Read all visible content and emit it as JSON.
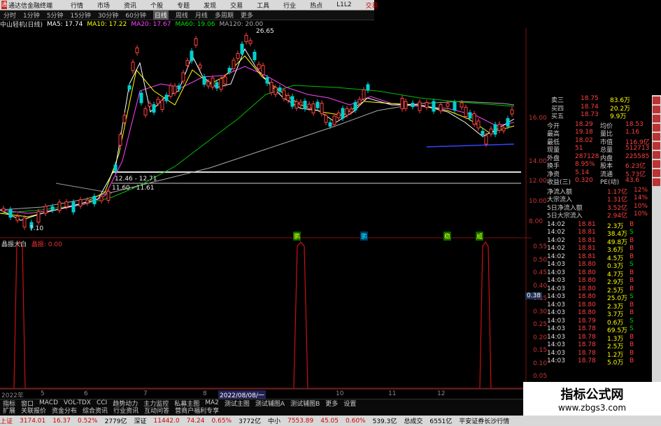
{
  "title": {
    "app": "通达信金融终端",
    "menus": [
      "行情",
      "市场",
      "资讯",
      "个股",
      "专题",
      "发现",
      "交易",
      "工具",
      "行业",
      "热点",
      "L1L2"
    ],
    "right": "交易"
  },
  "tabs": [
    "分时",
    "1分钟",
    "5分钟",
    "15分钟",
    "30分钟",
    "60分钟",
    "日线",
    "周线",
    "月线",
    "多周期",
    "更多"
  ],
  "active_tab": "日线",
  "stock_label": "中山轻机(日线)",
  "ma": [
    {
      "label": "MA5: 17.74",
      "color": "#ffffff"
    },
    {
      "label": "MA10: 17.22",
      "color": "#ffff00"
    },
    {
      "label": "MA20: 17.67",
      "color": "#ff44ff"
    },
    {
      "label": "MA60: 19.06",
      "color": "#00e000"
    },
    {
      "label": "MA120: 20.00",
      "color": "#aaaaaa"
    }
  ],
  "price_annotations": {
    "high": "26.65",
    "low": "7.10",
    "line1": "12.46 - 12.71",
    "line2": "11.60 - 11.61"
  },
  "price_axis": [
    "16.00",
    "14.00",
    "12.00",
    "10.00",
    "8.00"
  ],
  "indicator": {
    "name": "晶振大白",
    "value": "晶振: 0.00",
    "markers": [
      "鹏",
      "鹏",
      "稳",
      "威"
    ],
    "axis": [
      "0.55",
      "0.50",
      "0.45",
      "0.40",
      "0.35",
      "0.30",
      "0.25",
      "0.20",
      "0.15",
      "0.10",
      "0.05"
    ],
    "cursor": "0.38"
  },
  "date_labels": [
    "2022年",
    "5",
    "6",
    "7",
    "8",
    "2022/08/08/一",
    "10",
    "11",
    "12"
  ],
  "toolbar1": [
    "指标",
    "窗口",
    "MACD",
    "VOL-TDX",
    "CCI",
    "趋势动力",
    "主力监控",
    "私募主图",
    "MA2",
    "测试主图",
    "测试辅图A",
    "测试辅图B",
    "更多",
    "设置"
  ],
  "toolbar2": [
    "扩展",
    "关联报价",
    "资金分布",
    "综合资讯",
    "行业资讯",
    "互动问答",
    "营商户福利专享"
  ],
  "quote_rows": [
    {
      "l": "卖三",
      "p": "18.75",
      "v": "83.6万"
    },
    {
      "l": "买四",
      "p": "18.74",
      "v": "20.2万"
    },
    {
      "l": "买五",
      "p": "18.73",
      "v": "9.9万"
    }
  ],
  "stats": [
    {
      "l1": "今开",
      "v1": "18.29",
      "l2": "均价",
      "v2": "18.53"
    },
    {
      "l1": "最高",
      "v1": "19.18",
      "l2": "量比",
      "v2": "1.16"
    },
    {
      "l1": "最低",
      "v1": "18.02",
      "l2": "市值",
      "v2": "116.9亿"
    },
    {
      "l1": "现量",
      "v1": "51",
      "l2": "总量",
      "v2": "512713"
    },
    {
      "l1": "外盘",
      "v1": "287128",
      "l2": "内盘",
      "v2": "225585"
    },
    {
      "l1": "换手",
      "v1": "8.95%",
      "l2": "股本",
      "v2": "6.23亿"
    },
    {
      "l1": "净资",
      "v1": "5.14",
      "l2": "流通",
      "v2": "5.73亿"
    },
    {
      "l1": "收益(三)",
      "v1": "0.320",
      "l2": "PE(动)",
      "v2": "43.6"
    }
  ],
  "flows": [
    {
      "l": "净流入额",
      "v": "1.17亿",
      "p": "12%"
    },
    {
      "l": "大宗流入",
      "v": "1.31亿",
      "p": "14%"
    },
    {
      "l": "5日净流入额",
      "v": "3.52亿",
      "p": "10%"
    },
    {
      "l": "5日大宗流入",
      "v": "2.94亿",
      "p": "10%"
    }
  ],
  "ticks": [
    {
      "t": "14:02",
      "p": "18.81",
      "v": "2.3万",
      "s": "B"
    },
    {
      "t": "14:02",
      "p": "18.81",
      "v": "38.4万",
      "s": "S"
    },
    {
      "t": "14:02",
      "p": "18.81",
      "v": "49.8万",
      "s": "B"
    },
    {
      "t": "14:02",
      "p": "18.81",
      "v": "3.6万",
      "s": "B"
    },
    {
      "t": "14:02",
      "p": "18.81",
      "v": "4.5万",
      "s": "B"
    },
    {
      "t": "14:03",
      "p": "18.80",
      "v": "0.3万",
      "s": "S"
    },
    {
      "t": "14:03",
      "p": "18.80",
      "v": "4.7万",
      "s": "B"
    },
    {
      "t": "14:03",
      "p": "18.80",
      "v": "2.9万",
      "s": "B"
    },
    {
      "t": "14:03",
      "p": "18.80",
      "v": "2.5万",
      "s": "B"
    },
    {
      "t": "14:03",
      "p": "18.80",
      "v": "25.0万",
      "s": "S"
    },
    {
      "t": "14:03",
      "p": "18.80",
      "v": "2.3万",
      "s": "B"
    },
    {
      "t": "14:03",
      "p": "18.80",
      "v": "3.7万",
      "s": "B"
    },
    {
      "t": "14:03",
      "p": "18.79",
      "v": "0.6万",
      "s": "S"
    },
    {
      "t": "14:03",
      "p": "18.78",
      "v": "69.5万",
      "s": "S"
    },
    {
      "t": "14:03",
      "p": "18.78",
      "v": "1.3万",
      "s": "B"
    },
    {
      "t": "14:03",
      "p": "18.78",
      "v": "2.5万",
      "s": "B"
    },
    {
      "t": "14:03",
      "p": "18.78",
      "v": "1.2万",
      "s": "B"
    },
    {
      "t": "14:03",
      "p": "18.78",
      "v": "5.0万",
      "s": "B"
    }
  ],
  "status": {
    "sh_label": "上证",
    "sh": "3174.01",
    "sh_chg": "16.37",
    "sh_pct": "0.52%",
    "sh_amt": "2779亿",
    "sz_label": "深证",
    "sz": "11442.0",
    "sz_chg": "74.24",
    "sz_pct": "0.65%",
    "sz_amt": "3772亿",
    "zx_label": "中小",
    "zx": "7553.89",
    "zx_chg": "45.05",
    "zx_pct": "0.60%",
    "zx_amt": "539.3亿",
    "total_label": "总成交",
    "total": "6551亿",
    "broker": "平安证券长沙行情"
  },
  "watermark": {
    "line1": "指标公式网",
    "line2": "www.zbgs3.com"
  }
}
